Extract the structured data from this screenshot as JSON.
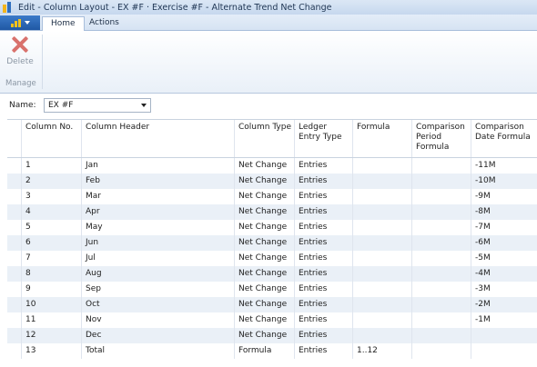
{
  "window": {
    "title": "Edit - Column Layout - EX #F · Exercise #F - Alternate Trend Net Change"
  },
  "ribbon": {
    "tabs": [
      {
        "label": "Home",
        "active": true
      },
      {
        "label": "Actions",
        "active": false
      }
    ],
    "delete_label": "Delete",
    "group_label": "Manage"
  },
  "name_field": {
    "label": "Name:",
    "value": "EX #F"
  },
  "table": {
    "headers": {
      "column_no": "Column No.",
      "column_header": "Column Header",
      "column_type": "Column Type",
      "ledger_entry_type": "Ledger Entry Type",
      "formula": "Formula",
      "comparison_period_formula": "Comparison Period Formula",
      "comparison_date_formula": "Comparison Date Formula"
    },
    "rows": [
      {
        "no": "1",
        "header": "Jan",
        "type": "Net Change",
        "ledger": "Entries",
        "formula": "",
        "cpf": "",
        "cdf": "-11M"
      },
      {
        "no": "2",
        "header": "Feb",
        "type": "Net Change",
        "ledger": "Entries",
        "formula": "",
        "cpf": "",
        "cdf": "-10M"
      },
      {
        "no": "3",
        "header": "Mar",
        "type": "Net Change",
        "ledger": "Entries",
        "formula": "",
        "cpf": "",
        "cdf": "-9M"
      },
      {
        "no": "4",
        "header": "Apr",
        "type": "Net Change",
        "ledger": "Entries",
        "formula": "",
        "cpf": "",
        "cdf": "-8M"
      },
      {
        "no": "5",
        "header": "May",
        "type": "Net Change",
        "ledger": "Entries",
        "formula": "",
        "cpf": "",
        "cdf": "-7M"
      },
      {
        "no": "6",
        "header": "Jun",
        "type": "Net Change",
        "ledger": "Entries",
        "formula": "",
        "cpf": "",
        "cdf": "-6M"
      },
      {
        "no": "7",
        "header": "Jul",
        "type": "Net Change",
        "ledger": "Entries",
        "formula": "",
        "cpf": "",
        "cdf": "-5M"
      },
      {
        "no": "8",
        "header": "Aug",
        "type": "Net Change",
        "ledger": "Entries",
        "formula": "",
        "cpf": "",
        "cdf": "-4M"
      },
      {
        "no": "9",
        "header": "Sep",
        "type": "Net Change",
        "ledger": "Entries",
        "formula": "",
        "cpf": "",
        "cdf": "-3M"
      },
      {
        "no": "10",
        "header": "Oct",
        "type": "Net Change",
        "ledger": "Entries",
        "formula": "",
        "cpf": "",
        "cdf": "-2M"
      },
      {
        "no": "11",
        "header": "Nov",
        "type": "Net Change",
        "ledger": "Entries",
        "formula": "",
        "cpf": "",
        "cdf": "-1M"
      },
      {
        "no": "12",
        "header": "Dec",
        "type": "Net Change",
        "ledger": "Entries",
        "formula": "",
        "cpf": "",
        "cdf": ""
      },
      {
        "no": "13",
        "header": "Total",
        "type": "Formula",
        "ledger": "Entries",
        "formula": "1..12",
        "cpf": "",
        "cdf": ""
      }
    ]
  }
}
